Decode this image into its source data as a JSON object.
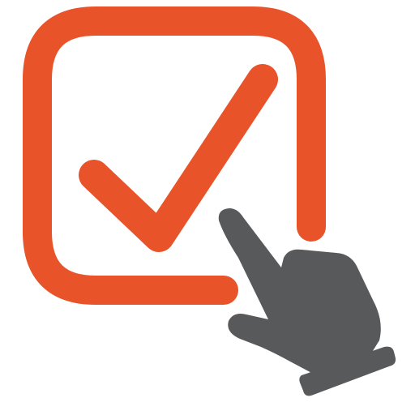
{
  "icon": {
    "name": "checkbox-click-icon",
    "accent_color": "#E8532A",
    "hand_color": "#58595B",
    "background": "#FFFFFF"
  }
}
